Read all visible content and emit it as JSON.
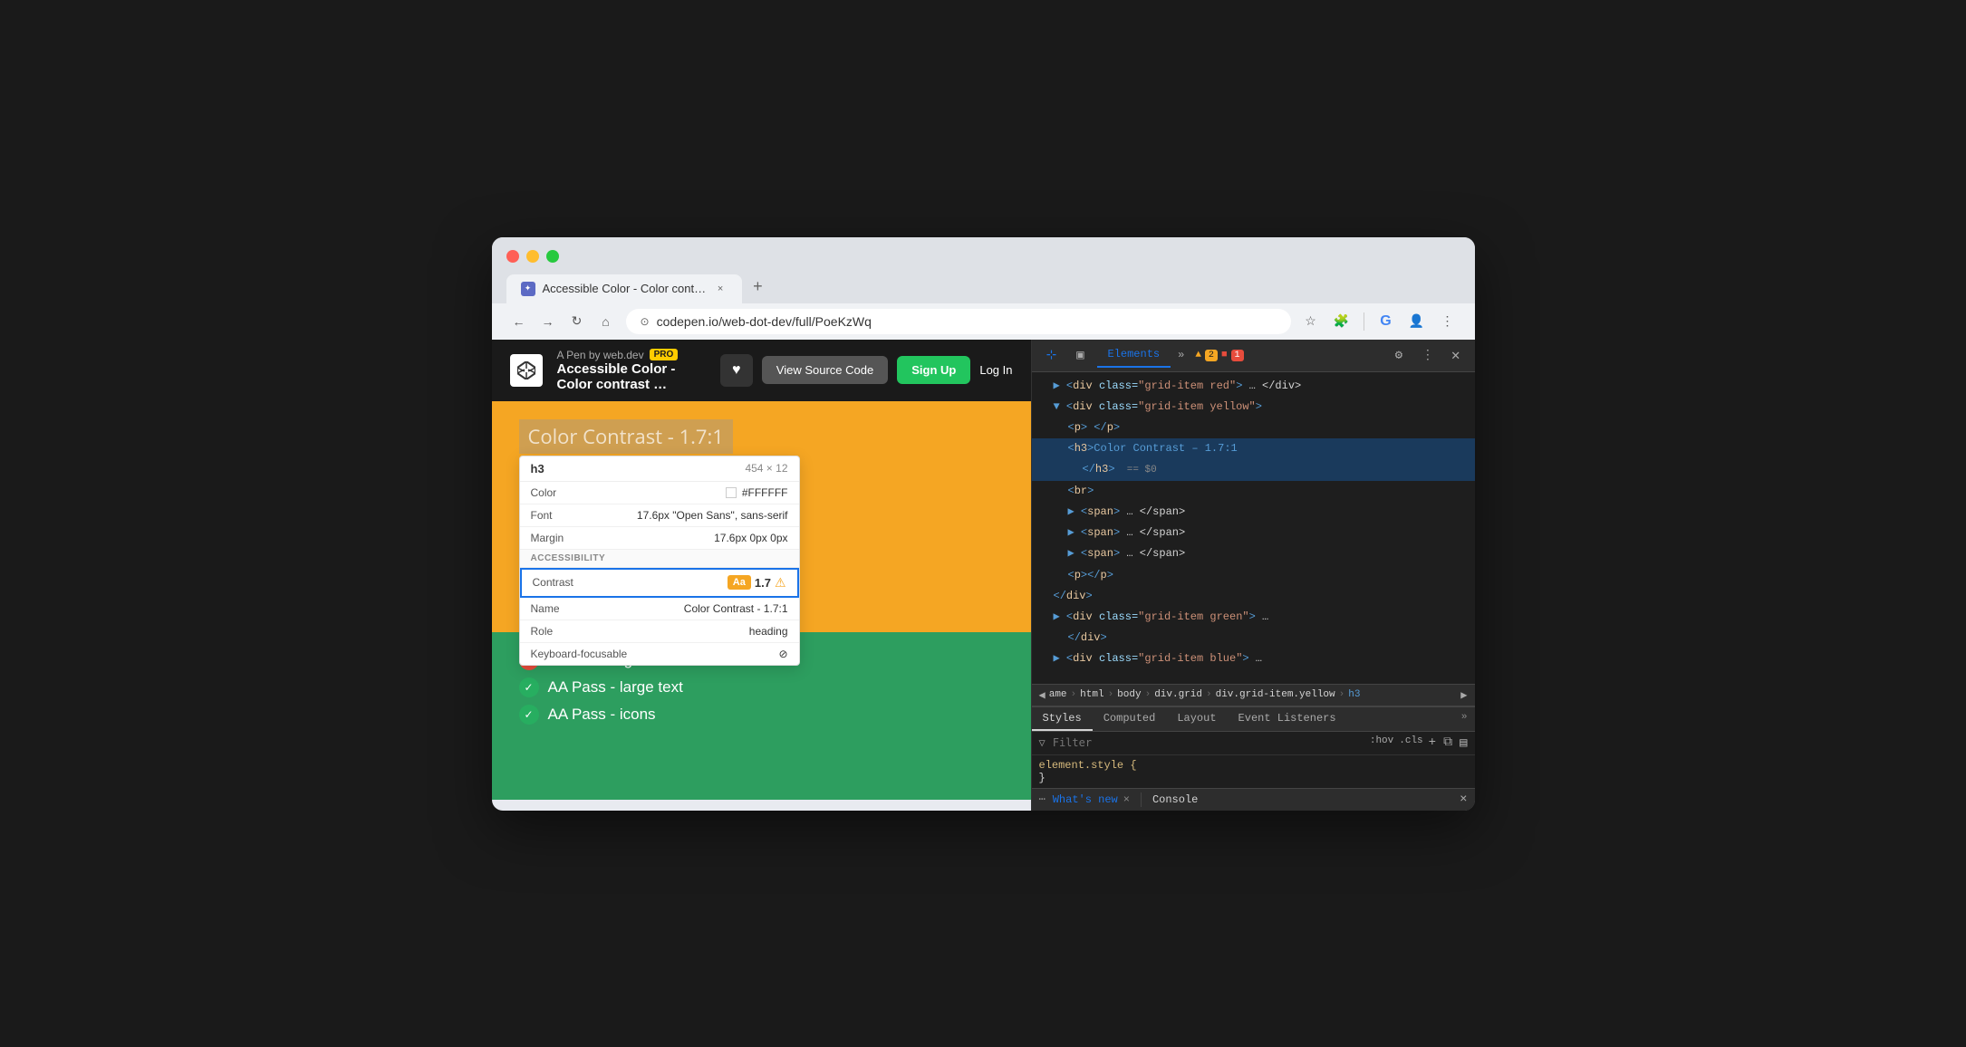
{
  "browser": {
    "tab_title": "Accessible Color - Color cont…",
    "tab_icon": "✦",
    "url": "codepen.io/web-dot-dev/full/PoeKzWq",
    "close_label": "×",
    "new_tab_label": "+"
  },
  "codepen": {
    "meta": "A Pen by web.dev",
    "pro_label": "PRO",
    "pen_title": "Accessible Color - Color contrast …",
    "heart_icon": "♥",
    "view_source_label": "View Source Code",
    "signup_label": "Sign Up",
    "login_label": "Log In"
  },
  "page": {
    "heading": "Color Contrast - 1.7:1",
    "aa_fail": "AA Fail - regular text",
    "aa_pass_large": "AA Pass - large text",
    "aa_pass_icons": "AA Pass - icons"
  },
  "inspector": {
    "element_label": "h3",
    "dimensions": "454 × 12",
    "color_label": "Color",
    "color_value": "#FFFFFF",
    "font_label": "Font",
    "font_value": "17.6px \"Open Sans\", sans-serif",
    "margin_label": "Margin",
    "margin_value": "17.6px 0px 0px",
    "accessibility_header": "ACCESSIBILITY",
    "contrast_label": "Contrast",
    "contrast_aa_badge": "Aa",
    "contrast_value": "1.7",
    "contrast_warn_icon": "⚠",
    "name_label": "Name",
    "name_value": "Color Contrast - 1.7:1",
    "role_label": "Role",
    "role_value": "heading",
    "keyboard_label": "Keyboard-focusable",
    "keyboard_icon": "⊘"
  },
  "devtools": {
    "toolbar": {
      "cursor_icon": "⊹",
      "box_icon": "▣",
      "more_icon": "»",
      "warn_count": "2",
      "error_count": "1",
      "settings_icon": "⚙",
      "more_vert_icon": "⋮",
      "close_icon": "✕"
    },
    "tabs": {
      "elements_label": "Elements",
      "more_label": "»"
    },
    "html_lines": [
      {
        "indent": 1,
        "content": "▶ <div class=\"grid-item red\"> … </div>",
        "selected": false
      },
      {
        "indent": 1,
        "content": "▼ <div class=\"grid-item yellow\">",
        "selected": false
      },
      {
        "indent": 2,
        "content": "<p> </p>",
        "selected": false
      },
      {
        "indent": 2,
        "content": "<h3>Color Contrast – 1.7:1",
        "selected": true
      },
      {
        "indent": 3,
        "content": "</h3> == $0",
        "selected": true
      },
      {
        "indent": 2,
        "content": "<br>",
        "selected": false
      },
      {
        "indent": 2,
        "content": "▶ <span> … </span>",
        "selected": false
      },
      {
        "indent": 2,
        "content": "▶ <span> … </span>",
        "selected": false
      },
      {
        "indent": 2,
        "content": "▶ <span> … </span>",
        "selected": false
      },
      {
        "indent": 2,
        "content": "<p></p>",
        "selected": false
      },
      {
        "indent": 1,
        "content": "</div>",
        "selected": false
      },
      {
        "indent": 1,
        "content": "▶ <div class=\"grid-item green\"> …",
        "selected": false
      },
      {
        "indent": 2,
        "content": "</div>",
        "selected": false
      },
      {
        "indent": 1,
        "content": "▶ <div class=\"grid-item blue\"> …",
        "selected": false
      }
    ],
    "breadcrumbs": [
      "ame",
      "html",
      "body",
      "div.grid",
      "div.grid-item.yellow",
      "h3"
    ],
    "styles_tabs": [
      "Styles",
      "Computed",
      "Layout",
      "Event Listeners",
      "»"
    ],
    "filter_placeholder": "Filter",
    "filter_pseudo": [
      ":hov",
      ".cls"
    ],
    "element_style": {
      "selector": "element.style {",
      "close": "}"
    },
    "bottom": {
      "whats_new": "What's new",
      "close_icon": "×",
      "console": "Console",
      "bottom_close": "×"
    }
  }
}
